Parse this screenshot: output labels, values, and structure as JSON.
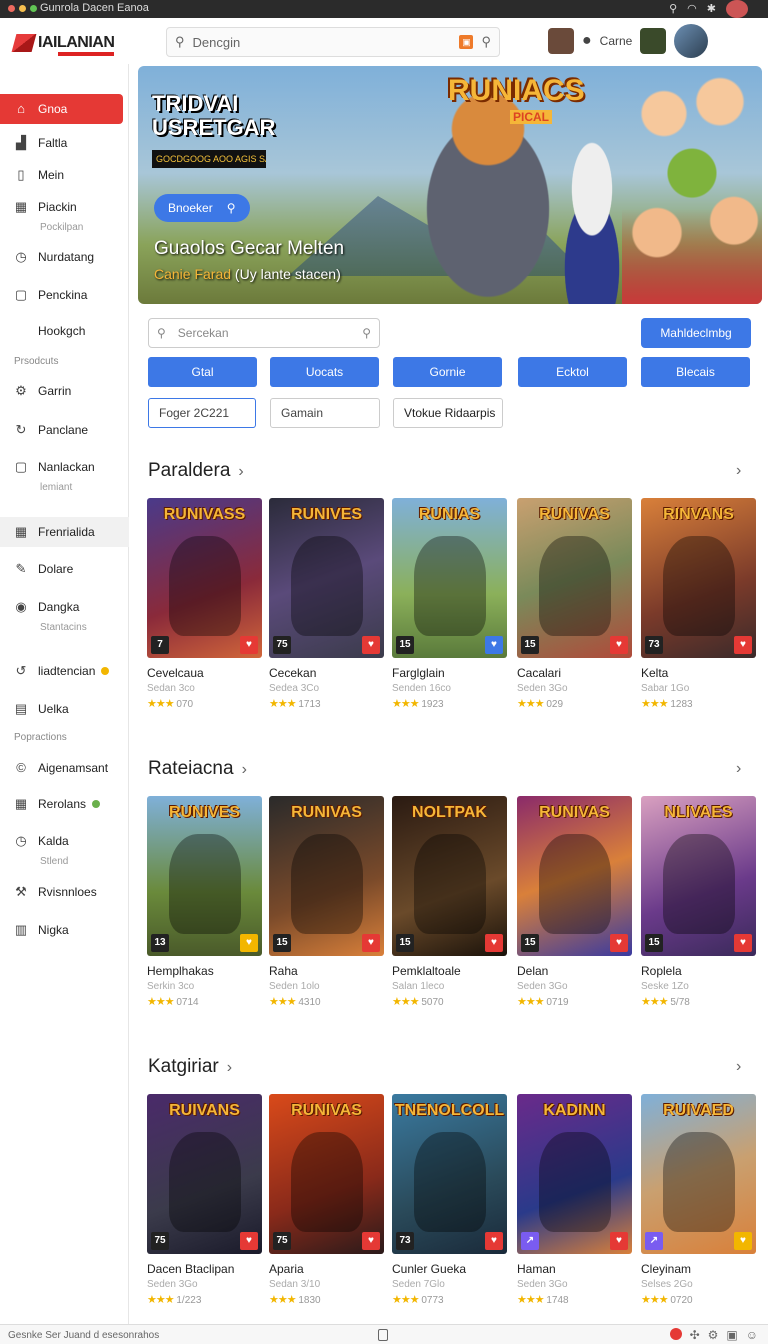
{
  "window": {
    "title": "Gunrola Dacen  Eanoa",
    "accent": "#e53935",
    "primary": "#3d78e6"
  },
  "header": {
    "logo": "IAILANIAN",
    "search_placeholder": "Dencgin",
    "user_label": "Carne"
  },
  "sidebar": {
    "items": [
      {
        "label": "Gnoa",
        "icon": "home-icon",
        "glyph": "⌂",
        "active": true
      },
      {
        "label": "Faltla",
        "icon": "chart-icon",
        "glyph": "▟"
      },
      {
        "label": "Mein",
        "icon": "book-icon",
        "glyph": "▯"
      },
      {
        "label": "Piackin",
        "icon": "grid-icon",
        "glyph": "▦",
        "sub": "Pockilpan"
      },
      {
        "label": "Nurdatang",
        "icon": "clock-icon",
        "glyph": "◷"
      },
      {
        "label": "Penckina",
        "icon": "box-icon",
        "glyph": "▢"
      },
      {
        "label": "Hookgch",
        "icon": "hook-icon",
        "glyph": ""
      }
    ],
    "section1": "Prsodcuts",
    "items2": [
      {
        "label": "Garrin",
        "icon": "gear-icon",
        "glyph": "⚙"
      },
      {
        "label": "Panclane",
        "icon": "refresh-icon",
        "glyph": "↻"
      },
      {
        "label": "Nanlackan",
        "icon": "square-icon",
        "glyph": "▢",
        "sub": "lemiant"
      },
      {
        "label": "Frenrialida",
        "icon": "grid-icon",
        "glyph": "▦",
        "hover": true
      },
      {
        "label": "Dolare",
        "icon": "edit-icon",
        "glyph": "✎"
      },
      {
        "label": "Dangka",
        "icon": "camera-icon",
        "glyph": "◉",
        "sub": "Stantacins"
      },
      {
        "label": "liadtencian",
        "icon": "cycle-icon",
        "glyph": "↺",
        "pill": "yellow"
      },
      {
        "label": "Uelka",
        "icon": "box-icon",
        "glyph": "▤"
      }
    ],
    "section2": "Popractions",
    "items3": [
      {
        "label": "Aigenamsant",
        "icon": "circle-icon",
        "glyph": "©"
      },
      {
        "label": "Rerolans",
        "icon": "grid-icon",
        "glyph": "▦",
        "pill": "green"
      },
      {
        "label": "Kalda",
        "icon": "clock-icon",
        "glyph": "◷",
        "sub": "Stlend"
      },
      {
        "label": "Rvisnnloes",
        "icon": "tools-icon",
        "glyph": "⚒"
      },
      {
        "label": "Nigka",
        "icon": "building-icon",
        "glyph": "▥"
      }
    ]
  },
  "hero": {
    "title": "TRIDVAI\nUSRETGAR",
    "strip": "GOCDGOOG AOO AGIS SAGD",
    "logo": "RUNIACS",
    "logo_sub": "PICAL",
    "button": "Bnoeker",
    "heading": "Guaolos Gecar Melten",
    "sub_hl": "Canie Farad",
    "sub_rest": " (Uy lante stacen)"
  },
  "filters": {
    "search_placeholder": "Sercekan",
    "action": "Mahldeclmbg",
    "chips": [
      "Gtal",
      "Uocats",
      "Gornie",
      "Ecktol",
      "Blecais"
    ],
    "fields": [
      "Foger 2C221",
      "Gamain",
      "Vtokue Ridaarpis"
    ]
  },
  "rows": [
    {
      "title": "Paraldera",
      "cards": [
        {
          "art": "RUNIVASS",
          "title": "Cevelcaua",
          "sub": "Sedan 3co",
          "count": "070",
          "age": "7",
          "bg": "linear-gradient(160deg,#4a3a8a,#8a2a3a 60%,#d1663a)",
          "fav": "#e53935"
        },
        {
          "art": "RUNIVES",
          "title": "Cecekan",
          "sub": "Sedea 3Co",
          "count": "1713",
          "age": "75",
          "bg": "linear-gradient(160deg,#2b2b3a,#5a4a7a 50%,#3b3b4b)",
          "fav": "#e53935"
        },
        {
          "art": "RUNIAS",
          "title": "Farglglain",
          "sub": "Senden 16co",
          "count": "1923",
          "age": "15",
          "bg": "linear-gradient(180deg,#7fb0d9,#8bb05a 60%,#5a7a3b)",
          "fav": "#3d78e6"
        },
        {
          "art": "RUNIVAS",
          "title": "Cacalari",
          "sub": "Seden 3Go",
          "count": "029",
          "age": "15",
          "bg": "linear-gradient(160deg,#c9a070,#7a8a5a 50%,#b04a3a)",
          "fav": "#e53935"
        },
        {
          "art": "RINVANS",
          "title": "Kelta",
          "sub": "Sabar 1Go",
          "count": "1283",
          "age": "73",
          "bg": "linear-gradient(160deg,#d9803a,#7a3a2a 60%,#3b2a2a)",
          "fav": "#e53935"
        }
      ]
    },
    {
      "title": "Rateiacna",
      "cards": [
        {
          "art": "RUNIVES",
          "title": "Hemplhakas",
          "sub": "Serkin 3co",
          "count": "0714",
          "age": "13",
          "bg": "linear-gradient(180deg,#7fb0d9,#6a8a3b 60%,#4a5a2a)",
          "fav": "#f2b600"
        },
        {
          "art": "RUNIVAS",
          "title": "Raha",
          "sub": "Seden 1olo",
          "count": "4310",
          "age": "15",
          "bg": "linear-gradient(160deg,#2a2a2a,#7a4a2a 60%,#d9803a)",
          "fav": "#e53935"
        },
        {
          "art": "NOLTPAK",
          "title": "Pemklaltoale",
          "sub": "Salan 1leco",
          "count": "5070",
          "age": "15",
          "bg": "linear-gradient(160deg,#2a1a12,#6a4a2a 60%,#1a120a)",
          "fav": "#e53935"
        },
        {
          "art": "RUNIVAS",
          "title": "Delan",
          "sub": "Seden 3Go",
          "count": "0719",
          "age": "15",
          "bg": "linear-gradient(160deg,#8a2a6a,#d9803a 50%,#3a3aa0)",
          "fav": "#e53935"
        },
        {
          "art": "NLIVAES",
          "title": "Roplela",
          "sub": "Seske 1Zo",
          "count": "5/78",
          "age": "15",
          "bg": "linear-gradient(160deg,#d9a0c0,#6a3a8a 60%,#3a2a5a)",
          "fav": "#e53935"
        }
      ]
    },
    {
      "title": "Katgiriar",
      "cards": [
        {
          "art": "RUIVANS",
          "title": "Dacen Btaclipan",
          "sub": "Seden 3Go",
          "count": "1/223",
          "age": "75",
          "bg": "linear-gradient(160deg,#4a2a6a,#3b3b4b 60%,#1a1a2a)",
          "fav": "#e53935"
        },
        {
          "art": "RUNIVAS",
          "title": "Aparia",
          "sub": "Sedan 3/10",
          "count": "1830",
          "age": "75",
          "bg": "linear-gradient(160deg,#d94a1a,#8a2a1a 60%,#2a1a1a)",
          "fav": "#e53935"
        },
        {
          "art": "TNENOLCOLL",
          "title": "Cunler Gueka",
          "sub": "Seden 7Glo",
          "count": "0773",
          "age": "73",
          "bg": "linear-gradient(160deg,#3a7aa0,#2a4a5a 60%,#1a2a3a)",
          "fav": "#e53935"
        },
        {
          "art": "KADINN",
          "title": "Haman",
          "sub": "Seden 3Go",
          "count": "1748",
          "age": "",
          "bg": "linear-gradient(160deg,#6a2a8a,#2a3a8a 60%,#d9803a)",
          "fav": "#e53935"
        },
        {
          "art": "RUIVAED",
          "title": "Cleyinam",
          "sub": "Selses 2Go",
          "count": "0720",
          "age": "",
          "bg": "linear-gradient(160deg,#7fb0d9,#c9a070 50%,#d9803a)",
          "fav": "#f2b600"
        }
      ]
    }
  ],
  "statusbar": {
    "text": "Gesnke Ser  Juand d esesonrahos"
  }
}
